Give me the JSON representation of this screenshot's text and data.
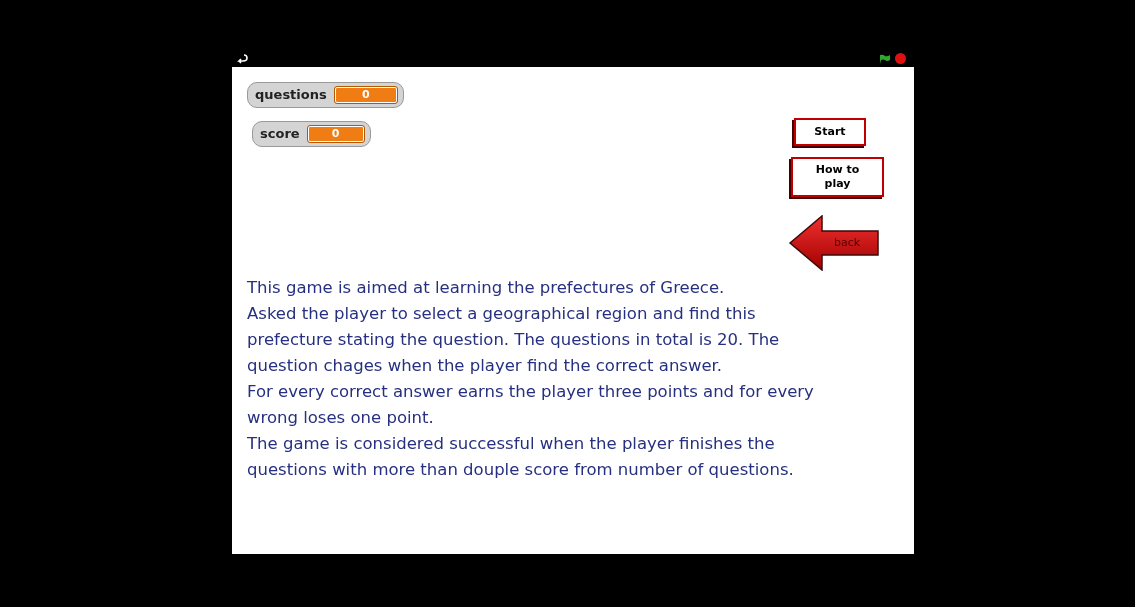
{
  "monitors": [
    {
      "label": "questions",
      "value": "0"
    },
    {
      "label": "score",
      "value": "0"
    }
  ],
  "buttons": [
    {
      "label": "Start"
    },
    {
      "label": "How to play"
    }
  ],
  "back_button": {
    "label": "back"
  },
  "instructions": [
    "This game is aimed at learning the prefectures of Greece.",
    "Asked the player to select a geographical region and find this",
    "prefecture stating the question. The questions  in total is 20. The",
    "question chages when the player find the correct answer.",
    "For every correct answer earns the player three points and for every",
    "wrong loses one point.",
    "The game is considered successful when the player finishes the",
    "questions with more than douple score from number of questions."
  ]
}
